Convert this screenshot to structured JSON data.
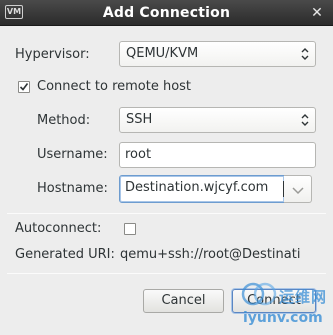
{
  "window": {
    "title": "Add Connection",
    "app_icon_text": "VM",
    "close_glyph": "✕"
  },
  "form": {
    "hypervisor": {
      "label": "Hypervisor:",
      "value": "QEMU/KVM"
    },
    "remote": {
      "label": "Connect to remote host",
      "checked": true,
      "check_glyph": "✓"
    },
    "method": {
      "label": "Method:",
      "value": "SSH"
    },
    "username": {
      "label": "Username:",
      "value": "root"
    },
    "hostname": {
      "label": "Hostname:",
      "value": "Destination.wjcyf.com"
    },
    "autoconnect": {
      "label": "Autoconnect:",
      "checked": false
    },
    "generated_uri": {
      "label": "Generated URI:",
      "value": "qemu+ssh://root@Destinati"
    }
  },
  "buttons": {
    "cancel": "Cancel",
    "connect": "Connect"
  },
  "watermark": {
    "cn": "运维网",
    "en": "iyunv.com"
  },
  "colors": {
    "titlebar": "#2b2b2b",
    "dialog_bg": "#ededed",
    "focus": "#6d9ccf",
    "watermark": "#3a8fd6"
  },
  "icons": {
    "combo_arrows": "up-down-chevron-icon",
    "dropdown": "chevron-down-icon",
    "close": "close-icon",
    "app": "virt-manager-icon"
  }
}
